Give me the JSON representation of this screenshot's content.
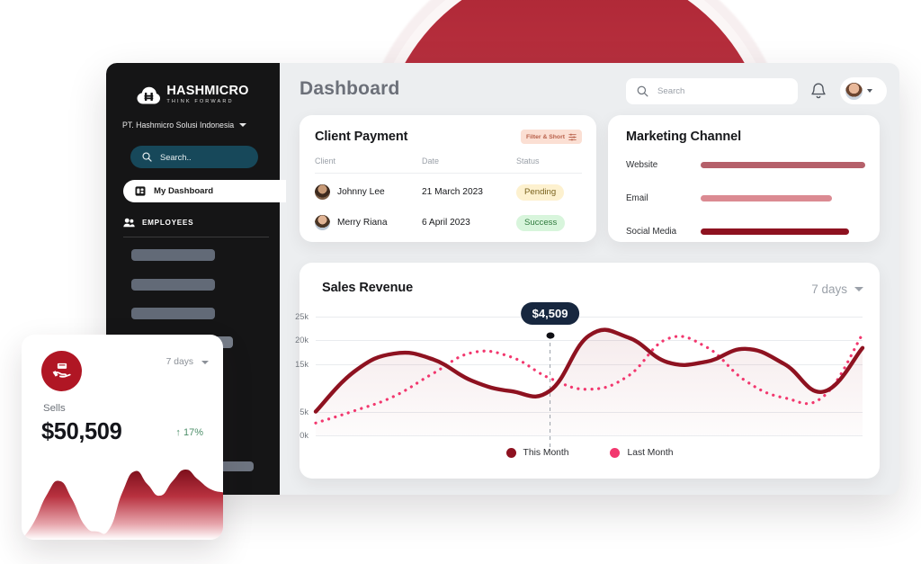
{
  "brand": {
    "logo_name": "HASHMICRO",
    "logo_tagline": "THINK FORWARD",
    "accent_dark_red": "#8E1220",
    "accent_red": "#B01624",
    "accent_pink": "#F2376E",
    "sidebar_bg": "#151516",
    "search_pill_bg": "#17485A"
  },
  "sidebar": {
    "company": "PT. Hashmicro Solusi Indonesia",
    "search_placeholder": "Search..",
    "active_item": "My Dashboard",
    "section_label": "EMPLOYEES",
    "placeholder_items": [
      "",
      "",
      "",
      ""
    ]
  },
  "header": {
    "title": "Dashboard",
    "search_placeholder": "Search"
  },
  "client_payment": {
    "title": "Client Payment",
    "filter_label": "Filter & Short",
    "columns": [
      "Client",
      "Date",
      "Status"
    ],
    "rows": [
      {
        "client": "Johnny Lee",
        "date": "21 March 2023",
        "status": "Pending",
        "status_type": "pending"
      },
      {
        "client": "Merry Riana",
        "date": "6 April 2023",
        "status": "Success",
        "status_type": "success"
      }
    ]
  },
  "marketing_channel": {
    "title": "Marketing Channel",
    "chart_data": {
      "type": "bar",
      "title": "Marketing Channel",
      "categories": [
        "Website",
        "Email",
        "Social Media"
      ],
      "values": [
        100,
        80,
        90
      ],
      "colors": [
        "#B5606A",
        "#DB8A92",
        "#8E1220"
      ],
      "xlabel": "",
      "ylabel": "",
      "ylim": [
        0,
        100
      ],
      "orientation": "horizontal",
      "grid": false,
      "legend": "none"
    }
  },
  "sales_revenue": {
    "title": "Sales Revenue",
    "range_label": "7 days",
    "tooltip_value": "$4,509",
    "legend": [
      {
        "label": "This Month",
        "color": "#8E1220"
      },
      {
        "label": "Last Month",
        "color": "#F2376E"
      }
    ],
    "chart_data": {
      "type": "line",
      "title": "Sales Revenue",
      "xlabel": "",
      "ylabel": "",
      "ytick_labels": [
        "25k",
        "20k",
        "15k",
        "5k",
        "0k"
      ],
      "ytick_values": [
        25000,
        20000,
        15000,
        5000,
        0
      ],
      "ylim": [
        0,
        26500
      ],
      "grid": true,
      "legend": "bottom-center",
      "annotation": {
        "label": "$4,509",
        "x_index": 6,
        "y": 21000
      },
      "x": [
        0,
        1,
        2,
        3,
        4,
        5,
        6,
        7,
        8,
        9,
        10,
        11,
        12,
        13,
        14
      ],
      "series": [
        {
          "name": "This Month",
          "color": "#8E1220",
          "style": "solid",
          "values": [
            5000,
            13500,
            17200,
            16000,
            11500,
            9300,
            9400,
            21000,
            20600,
            15400,
            15500,
            18200,
            15000,
            9200,
            18400
          ]
        },
        {
          "name": "Last Month",
          "color": "#F2376E",
          "style": "dashed",
          "values": [
            2600,
            5200,
            8200,
            13000,
            17400,
            16500,
            12000,
            9700,
            12500,
            20300,
            18600,
            11500,
            7900,
            8200,
            21300
          ]
        }
      ]
    }
  },
  "sells_card": {
    "icon": "sells-money-icon",
    "range_label": "7 days",
    "label": "Sells",
    "value": "$50,509",
    "delta": "↑ 17%",
    "chart_data": {
      "type": "area",
      "title": "Sells",
      "values": [
        0,
        22,
        55,
        72,
        50,
        18,
        10,
        14,
        58,
        84,
        68,
        54,
        72,
        86,
        74,
        62,
        58
      ],
      "color": "#8E1220",
      "grid": false,
      "legend": "none"
    }
  }
}
